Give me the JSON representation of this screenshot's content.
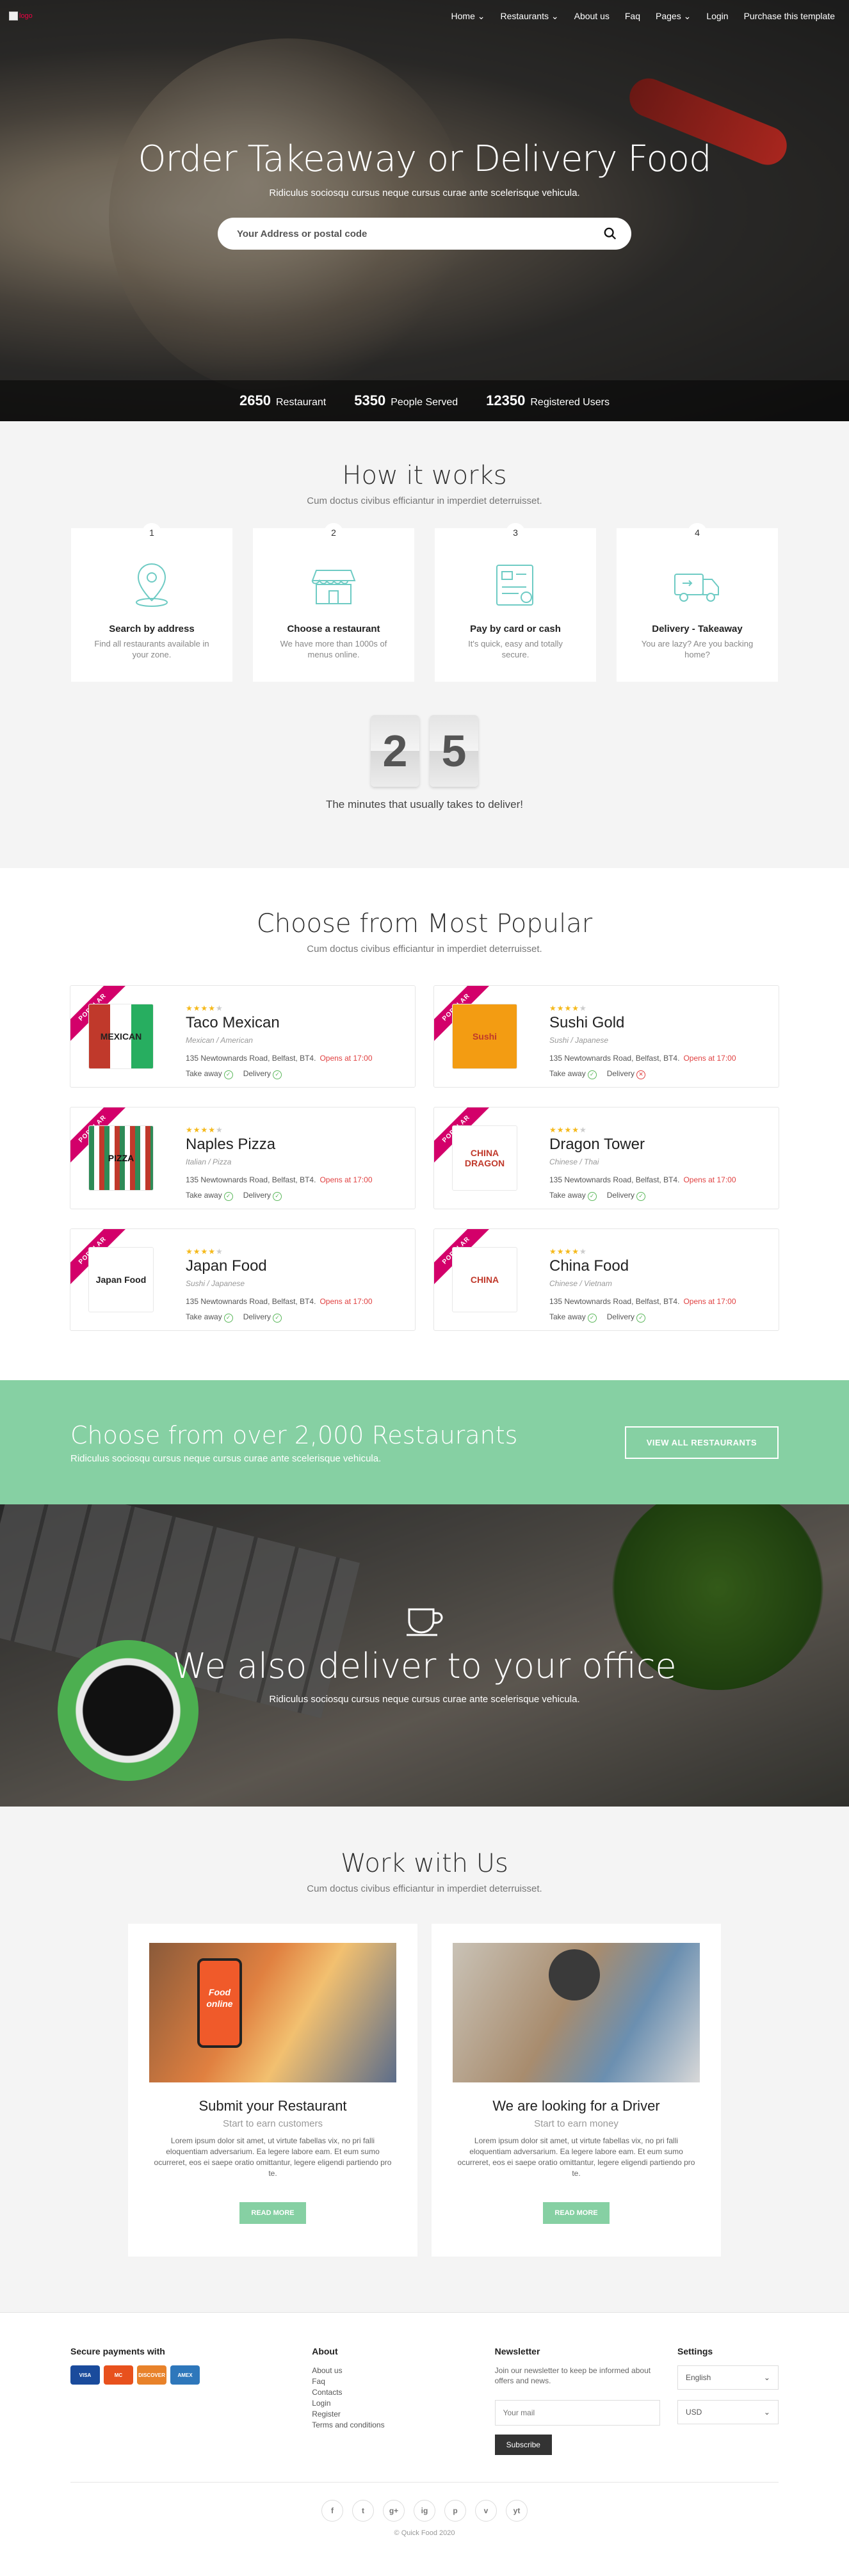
{
  "nav": {
    "logo_alt": "logo",
    "items": [
      "Home",
      "Restaurants",
      "About us",
      "Faq",
      "Pages",
      "Login",
      "Purchase this template"
    ],
    "dropdowns": [
      true,
      true,
      false,
      false,
      true,
      false,
      false
    ]
  },
  "hero": {
    "title": "Order Takeaway or Delivery Food",
    "subtitle": "Ridiculus sociosqu cursus neque cursus curae ante scelerisque vehicula.",
    "search_placeholder": "Your Address or postal code",
    "stats": [
      {
        "value": "2650",
        "label": "Restaurant"
      },
      {
        "value": "5350",
        "label": "People Served"
      },
      {
        "value": "12350",
        "label": "Registered Users"
      }
    ]
  },
  "how": {
    "title": "How it works",
    "subtitle": "Cum doctus civibus efficiantur in imperdiet deterruisset.",
    "steps": [
      {
        "num": "1",
        "title": "Search by address",
        "text": "Find all restaurants available in your zone.",
        "icon": "map-pin-icon"
      },
      {
        "num": "2",
        "title": "Choose a restaurant",
        "text": "We have more than 1000s of menus online.",
        "icon": "store-icon"
      },
      {
        "num": "3",
        "title": "Pay by card or cash",
        "text": "It's quick, easy and totally secure.",
        "icon": "payment-icon"
      },
      {
        "num": "4",
        "title": "Delivery - Takeaway",
        "text": "You are lazy? Are you backing home?",
        "icon": "truck-icon"
      }
    ],
    "counter": [
      "2",
      "5"
    ],
    "counter_text": "The minutes that usually takes to deliver!"
  },
  "popular": {
    "title": "Choose from Most Popular",
    "subtitle": "Cum doctus civibus efficiantur in imperdiet deterruisset.",
    "ribbon": "POPULAR",
    "restaurants": [
      {
        "name": "Taco Mexican",
        "type": "Mexican / American",
        "address": "135 Newtownards Road, Belfast, BT4.",
        "open": "Opens at 17:00",
        "takeaway": "Take away",
        "delivery": "Delivery",
        "delivery_ok": true,
        "logo": "MEXICAN",
        "rating": 4
      },
      {
        "name": "Sushi Gold",
        "type": "Sushi / Japanese",
        "address": "135 Newtownards Road, Belfast, BT4.",
        "open": "Opens at 17:00",
        "takeaway": "Take away",
        "delivery": "Delivery",
        "delivery_ok": false,
        "logo": "Sushi",
        "rating": 4
      },
      {
        "name": "Naples Pizza",
        "type": "Italian / Pizza",
        "address": "135 Newtownards Road, Belfast, BT4.",
        "open": "Opens at 17:00",
        "takeaway": "Take away",
        "delivery": "Delivery",
        "delivery_ok": true,
        "logo": "PIZZA",
        "rating": 4
      },
      {
        "name": "Dragon Tower",
        "type": "Chinese / Thai",
        "address": "135 Newtownards Road, Belfast, BT4.",
        "open": "Opens at 17:00",
        "takeaway": "Take away",
        "delivery": "Delivery",
        "delivery_ok": true,
        "logo": "CHINA DRAGON",
        "rating": 4
      },
      {
        "name": "Japan Food",
        "type": "Sushi / Japanese",
        "address": "135 Newtownards Road, Belfast, BT4.",
        "open": "Opens at 17:00",
        "takeaway": "Take away",
        "delivery": "Delivery",
        "delivery_ok": true,
        "logo": "Japan Food",
        "rating": 4
      },
      {
        "name": "China Food",
        "type": "Chinese / Vietnam",
        "address": "135 Newtownards Road, Belfast, BT4.",
        "open": "Opens at 17:00",
        "takeaway": "Take away",
        "delivery": "Delivery",
        "delivery_ok": true,
        "logo": "CHINA",
        "rating": 4
      }
    ]
  },
  "banner": {
    "title": "Choose from over 2,000 Restaurants",
    "subtitle": "Ridiculus sociosqu cursus neque cursus curae ante scelerisque vehicula.",
    "button": "VIEW ALL RESTAURANTS"
  },
  "office": {
    "title": "We also deliver to your office",
    "subtitle": "Ridiculus sociosqu cursus neque cursus curae ante scelerisque vehicula."
  },
  "work": {
    "title": "Work with Us",
    "subtitle": "Cum doctus civibus efficiantur in imperdiet deterruisset.",
    "cards": [
      {
        "title": "Submit your Restaurant",
        "sub": "Start to earn customers",
        "text": "Lorem ipsum dolor sit amet, ut virtute fabellas vix, no pri falli eloquentiam adversarium. Ea legere labore eam. Et eum sumo ocurreret, eos ei saepe oratio omittantur, legere eligendi partiendo pro te.",
        "button": "READ MORE",
        "phone_text": "Food online"
      },
      {
        "title": "We are looking for a Driver",
        "sub": "Start to earn money",
        "text": "Lorem ipsum dolor sit amet, ut virtute fabellas vix, no pri falli eloquentiam adversarium. Ea legere labore eam. Et eum sumo ocurreret, eos ei saepe oratio omittantur, legere eligendi partiendo pro te.",
        "button": "READ MORE"
      }
    ]
  },
  "footer": {
    "payments_title": "Secure payments with",
    "cards": [
      {
        "label": "VISA",
        "color": "#1a4b9c"
      },
      {
        "label": "MC",
        "color": "#e8511d"
      },
      {
        "label": "DISCOVER",
        "color": "#e8822a"
      },
      {
        "label": "AMEX",
        "color": "#2e77bb"
      }
    ],
    "about_title": "About",
    "about_links": [
      "About us",
      "Faq",
      "Contacts",
      "Login",
      "Register",
      "Terms and conditions"
    ],
    "newsletter_title": "Newsletter",
    "newsletter_text": "Join our newsletter to keep be informed about offers and news.",
    "newsletter_placeholder": "Your mail",
    "subscribe": "Subscribe",
    "settings_title": "Settings",
    "language": "English",
    "currency": "USD",
    "social": [
      "f",
      "t",
      "g+",
      "ig",
      "p",
      "v",
      "yt"
    ],
    "copyright": "© Quick Food 2020"
  },
  "colors": {
    "accent": "#86d0a3",
    "ribbon": "#d3006a",
    "icon": "#6ecbc4"
  }
}
